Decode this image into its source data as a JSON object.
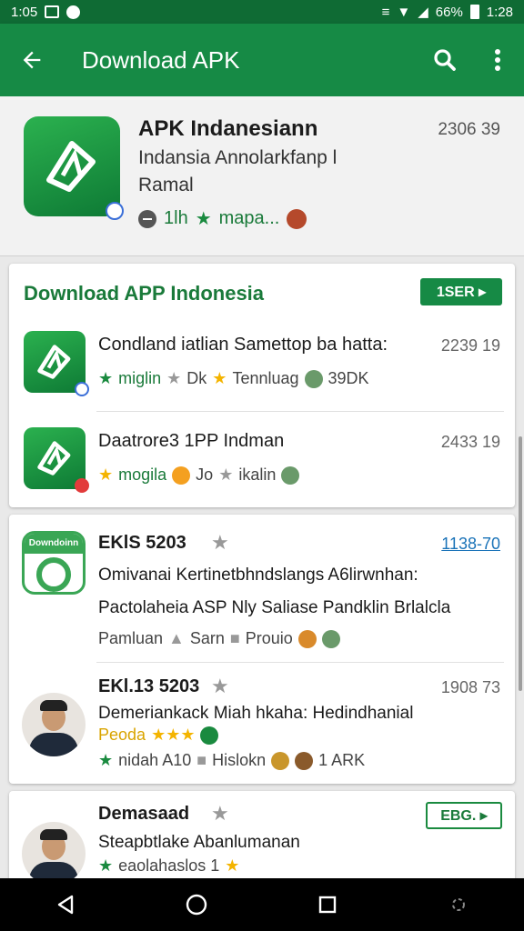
{
  "status_bar": {
    "time": "1:05",
    "right_time": "1:28",
    "battery": "66%"
  },
  "app_bar": {
    "title": "Download APK"
  },
  "hero": {
    "title": "APK Indanesiann",
    "number": "2306 39",
    "subtitle": "Indansia Annolarkfanp l",
    "subtitle2": "Ramal",
    "meta_text": "1lh",
    "meta_text2": "mapa..."
  },
  "section1": {
    "title": "Download APP Indonesia",
    "button_label": "1SER ▸",
    "rows": [
      {
        "title": "Condland iatlian Samettop ba hatta:",
        "number": "2239 19",
        "m1": "miglin",
        "m2": "Dk",
        "m3": "Tennluag",
        "m4": "39DK"
      },
      {
        "title": "Daatrore3 1PP Indman",
        "number": "2433 19",
        "m1": "mogila",
        "m2": "Jo",
        "m3": "ikalin"
      }
    ]
  },
  "section2": {
    "rows": [
      {
        "icon_label": "Downdoinn",
        "title": "EKlS 5203",
        "number": "1138-70",
        "line1": "Omivanai Kertinetbhndslangs A6lirwnhan:",
        "line2": "Pactolaheia ASP Nly Saliase Pandklin Brlalcla",
        "m1": "Pamluan",
        "m2": "Sarn",
        "m3": "Prouio"
      },
      {
        "title": "EKl.13 5203",
        "number": "1908 73",
        "line1": "Demeriankack Miah hkaha: Hedindhanial",
        "line2": "Peoda",
        "m1": "nidah A10",
        "m2": "Hislokn",
        "m3": "1 ARK"
      }
    ]
  },
  "section3": {
    "title": "Demasaad",
    "button_label": "EBG. ▸",
    "line1": "Steapbtlake Abanlumanan",
    "m1": "eaolahaslos 1"
  }
}
